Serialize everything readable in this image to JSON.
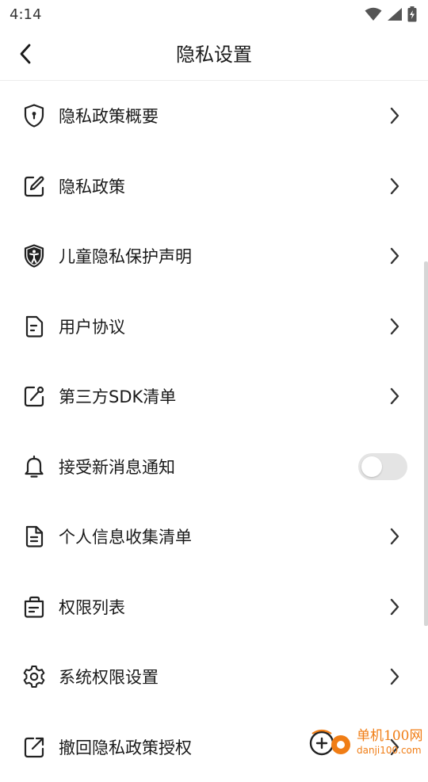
{
  "status_bar": {
    "time": "4:14"
  },
  "header": {
    "title": "隐私设置"
  },
  "menu": [
    {
      "label": "隐私政策概要",
      "icon": "shield-keyhole-icon",
      "control": "chevron"
    },
    {
      "label": "隐私政策",
      "icon": "edit-note-icon",
      "control": "chevron"
    },
    {
      "label": "儿童隐私保护声明",
      "icon": "child-shield-icon",
      "control": "chevron"
    },
    {
      "label": "用户协议",
      "icon": "document-icon",
      "control": "chevron"
    },
    {
      "label": "第三方SDK清单",
      "icon": "share-edit-icon",
      "control": "chevron"
    },
    {
      "label": "接受新消息通知",
      "icon": "bell-icon",
      "control": "toggle",
      "toggle_on": false
    },
    {
      "label": "个人信息收集清单",
      "icon": "file-list-icon",
      "control": "chevron"
    },
    {
      "label": "权限列表",
      "icon": "briefcase-list-icon",
      "control": "chevron"
    },
    {
      "label": "系统权限设置",
      "icon": "gear-icon",
      "control": "chevron"
    },
    {
      "label": "撤回隐私政策授权",
      "icon": "external-link-icon",
      "control": "chevron"
    }
  ],
  "watermark": {
    "cn": "单机100网",
    "url": "danji100.com"
  },
  "colors": {
    "toggle_off": "#e4e4e4",
    "watermark": "#f07d15",
    "divider": "#ececec"
  }
}
